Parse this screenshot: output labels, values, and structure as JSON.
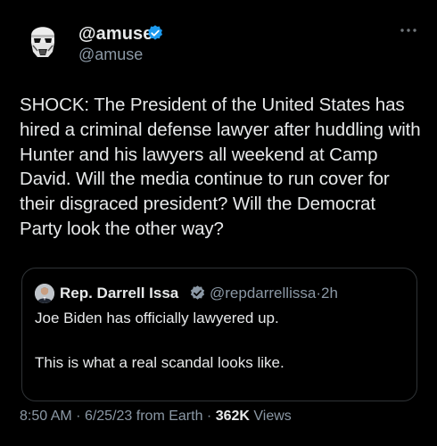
{
  "author": {
    "display_name": "@amuse",
    "handle": "@amuse",
    "verified": true,
    "avatar_icon": "stormtrooper-helmet-icon"
  },
  "more_icon": "more-options-icon",
  "tweet_text": "SHOCK: The President of the United States has hired a criminal defense lawyer after huddling with Hunter and his lawyers all weekend at Camp David. Will the media continue to run cover for their disgraced president? Will the Democrat Party look the other way?",
  "quoted": {
    "display_name": "Rep. Darrell Issa",
    "handle": "@repdarrellissa",
    "separator": "·",
    "age": "2h",
    "line1": "Joe Biden has officially lawyered up.",
    "line2": "This is what a real scandal looks like."
  },
  "footer": {
    "time": "8:50 AM",
    "dot1": "·",
    "date": "6/25/23",
    "source": "from Earth",
    "dot2": "·",
    "views_count": "362K",
    "views_label": "Views"
  },
  "colors": {
    "background": "#000000",
    "text": "#e7e9ea",
    "secondary": "#8b98a5",
    "verified": "#1d9bf0",
    "border": "#2f3336"
  }
}
